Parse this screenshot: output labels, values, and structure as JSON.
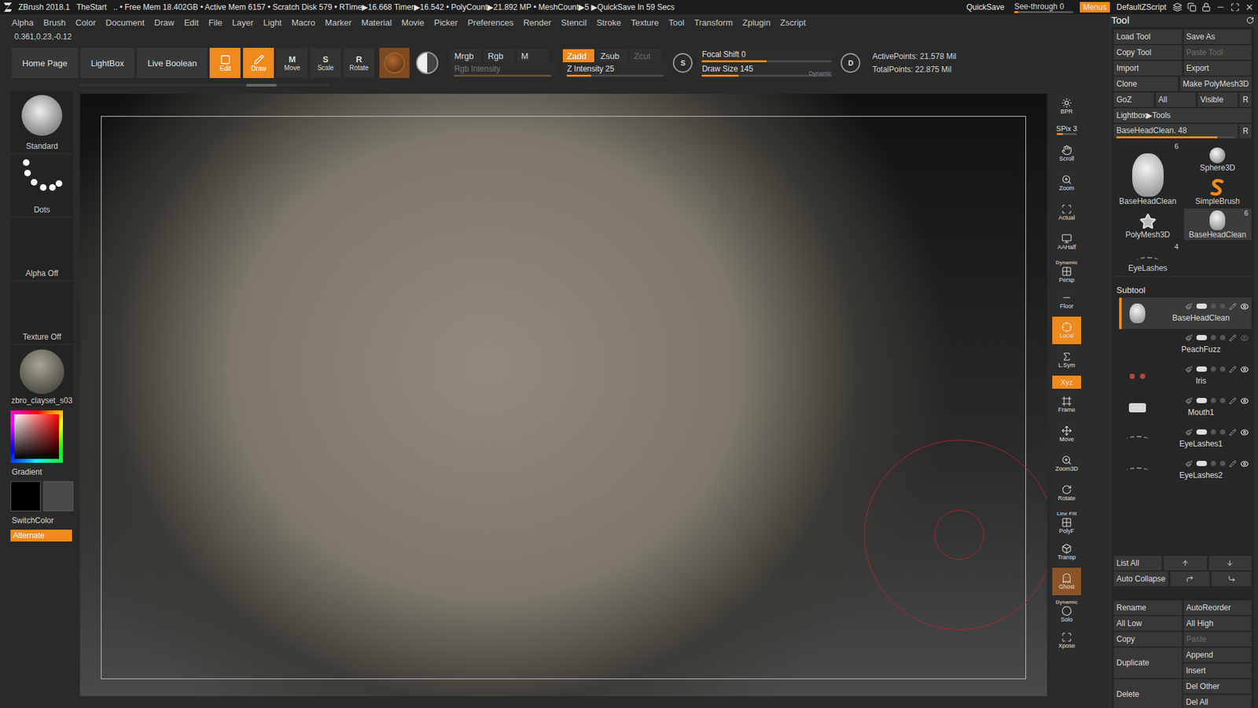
{
  "title_bar": {
    "app": "ZBrush 2018.1",
    "project": "TheStart",
    "status": ".. • Free Mem 18.402GB • Active Mem 6157 • Scratch Disk 579 • RTime▶16.668 Timer▶16.542 • PolyCount▶21.892 MP • MeshCount▶5 ▶QuickSave In 59 Secs",
    "quicksave": "QuickSave",
    "see_through": {
      "label": "See-through",
      "value": "0",
      "level": 0
    },
    "menus": {
      "label": "Menus",
      "selected": true
    },
    "script": "DefaultZScript"
  },
  "menu_bar": [
    "Alpha",
    "Brush",
    "Color",
    "Document",
    "Draw",
    "Edit",
    "File",
    "Layer",
    "Light",
    "Macro",
    "Marker",
    "Material",
    "Movie",
    "Picker",
    "Preferences",
    "Render",
    "Stencil",
    "Stroke",
    "Texture",
    "Tool",
    "Transform",
    "Zplugin",
    "Zscript"
  ],
  "coordinates": "0.361,0.23,-0.12",
  "shelf": {
    "nav_buttons": [
      "Home Page",
      "LightBox",
      "Live Boolean"
    ],
    "modes": [
      {
        "label": "Edit",
        "key": "",
        "selected": true
      },
      {
        "label": "Draw",
        "key": "",
        "selected": true
      },
      {
        "label": "Move",
        "key": "M",
        "selected": false
      },
      {
        "label": "Scale",
        "key": "S",
        "selected": false
      },
      {
        "label": "Rotate",
        "key": "R",
        "selected": false
      }
    ],
    "color_modes": [
      {
        "label": "Mrgb",
        "selected": false
      },
      {
        "label": "Rgb",
        "selected": false
      },
      {
        "label": "M",
        "selected": false
      }
    ],
    "rgb_intensity": {
      "label": "Rgb Intensity",
      "level": 1,
      "disabled": true
    },
    "z_modes": [
      {
        "label": "Zadd",
        "selected": true,
        "disabled": false
      },
      {
        "label": "Zsub",
        "selected": false,
        "disabled": false
      },
      {
        "label": "Zcut",
        "selected": false,
        "disabled": true
      }
    ],
    "z_intensity": {
      "label": "Z Intensity 25",
      "level": 0.25
    },
    "focal_shift": {
      "label": "Focal Shift 0",
      "key": "S",
      "level": 0.5
    },
    "draw_size": {
      "label": "Draw Size 145",
      "key": "D",
      "dynamic": "Dynamic",
      "level": 0.28
    },
    "points": [
      "ActivePoints: 21.578 Mil",
      "TotalPoints: 22.875 Mil"
    ]
  },
  "left_shelf": [
    {
      "label": "Standard",
      "kind": "brush"
    },
    {
      "label": "Dots",
      "kind": "stroke"
    },
    {
      "label": "Alpha Off",
      "kind": "empty"
    },
    {
      "label": "Texture Off",
      "kind": "empty"
    },
    {
      "label": "zbro_clayset_s03",
      "kind": "material"
    }
  ],
  "color": {
    "gradient": "Gradient",
    "main": "#000000",
    "secondary": "#4a4a4a",
    "switch": "SwitchColor",
    "alternate": {
      "label": "Alternate",
      "selected": true
    }
  },
  "right_shelf": [
    {
      "label": "BPR",
      "caption": "",
      "kind": "button",
      "selected": false
    },
    {
      "label": "SPix 3",
      "caption": "",
      "kind": "slider",
      "level": 0.3,
      "selected": false
    },
    {
      "label": "Scroll",
      "caption": "",
      "kind": "button",
      "selected": false
    },
    {
      "label": "Zoom",
      "caption": "",
      "kind": "button",
      "selected": false
    },
    {
      "label": "Actual",
      "caption": "",
      "kind": "button",
      "selected": false
    },
    {
      "label": "AAHalf",
      "caption": "",
      "kind": "button",
      "selected": false
    },
    {
      "label": "Persp",
      "caption": "Dynamic",
      "kind": "button",
      "selected": false
    },
    {
      "label": "Floor",
      "caption": "",
      "kind": "button",
      "selected": false
    },
    {
      "label": "Local",
      "caption": "",
      "kind": "button",
      "selected": true
    },
    {
      "label": "L.Sym",
      "caption": "",
      "kind": "button",
      "selected": false
    },
    {
      "label": "Xyz",
      "caption": "",
      "kind": "small",
      "selected": true
    },
    {
      "label": "Frame",
      "caption": "",
      "kind": "button",
      "selected": false
    },
    {
      "label": "Move",
      "caption": "",
      "kind": "button",
      "selected": false
    },
    {
      "label": "Zoom3D",
      "caption": "",
      "kind": "button",
      "selected": false
    },
    {
      "label": "Rotate",
      "caption": "",
      "kind": "button",
      "selected": false
    },
    {
      "label": "PolyF",
      "caption": "Line Fill",
      "kind": "button",
      "selected": false
    },
    {
      "label": "Transp",
      "caption": "",
      "kind": "button",
      "selected": false
    },
    {
      "label": "Ghost",
      "caption": "",
      "kind": "dim",
      "selected": true
    },
    {
      "label": "Solo",
      "caption": "Dynamic",
      "kind": "button",
      "selected": false
    },
    {
      "label": "Xpose",
      "caption": "",
      "kind": "button",
      "selected": false
    }
  ],
  "tool_panel": {
    "title": "Tool",
    "button_rows": [
      [
        {
          "label": "Load Tool",
          "disabled": false
        },
        {
          "label": "Save As",
          "disabled": false
        }
      ],
      [
        {
          "label": "Copy Tool",
          "disabled": false
        },
        {
          "label": "Paste Tool",
          "disabled": true
        }
      ],
      [
        {
          "label": "Import",
          "disabled": false
        },
        {
          "label": "Export",
          "disabled": false
        }
      ],
      [
        {
          "label": "Clone",
          "disabled": false
        },
        {
          "label": "Make PolyMesh3D",
          "disabled": false
        }
      ],
      [
        {
          "label": "GoZ",
          "disabled": false
        },
        {
          "label": "All",
          "disabled": false
        },
        {
          "label": "Visible",
          "disabled": false
        },
        {
          "label": "R",
          "disabled": false
        }
      ]
    ],
    "lightbox": "Lightbox▶Tools",
    "current_tool": {
      "label": "BaseHeadClean. 48",
      "level": 0.85,
      "reset": "R"
    },
    "tools": [
      {
        "label": "BaseHeadClean",
        "count": "6",
        "kind": "head",
        "selected": false
      },
      {
        "label": "Sphere3D",
        "count": "",
        "kind": "sphere",
        "selected": false
      },
      {
        "label": "SimpleBrush",
        "count": "",
        "kind": "brush",
        "selected": false
      },
      {
        "label": "PolyMesh3D",
        "count": "",
        "kind": "star",
        "selected": false
      },
      {
        "label": "BaseHeadClean",
        "count": "6",
        "kind": "head",
        "selected": true
      },
      {
        "label": "EyeLashes",
        "count": "4",
        "kind": "lashes",
        "selected": false
      }
    ],
    "subtool": {
      "title": "Subtool",
      "items": [
        {
          "name": "BaseHeadClean",
          "kind": "head",
          "selected": true,
          "visible": true
        },
        {
          "name": "PeachFuzz",
          "kind": "none",
          "selected": false,
          "visible": false
        },
        {
          "name": "Iris",
          "kind": "eyes",
          "selected": false,
          "visible": true
        },
        {
          "name": "Mouth1",
          "kind": "mouth",
          "selected": false,
          "visible": true
        },
        {
          "name": "EyeLashes1",
          "kind": "lashes",
          "selected": false,
          "visible": true
        },
        {
          "name": "EyeLashes2",
          "kind": "lashes",
          "selected": false,
          "visible": true
        }
      ]
    },
    "list_buttons": [
      "List All",
      "Auto Collapse"
    ],
    "action_rows": [
      [
        {
          "label": "Rename",
          "disabled": false
        },
        {
          "label": "AutoReorder",
          "disabled": false
        }
      ],
      [
        {
          "label": "All Low",
          "disabled": false
        },
        {
          "label": "All High",
          "disabled": false
        }
      ],
      [
        {
          "label": "Copy",
          "disabled": false
        },
        {
          "label": "Paste",
          "disabled": true
        }
      ]
    ],
    "action_groups": [
      {
        "main": "Duplicate",
        "side": [
          "Append",
          "Insert"
        ]
      },
      {
        "main": "Delete",
        "side": [
          "Del Other",
          "Del All"
        ]
      }
    ]
  }
}
